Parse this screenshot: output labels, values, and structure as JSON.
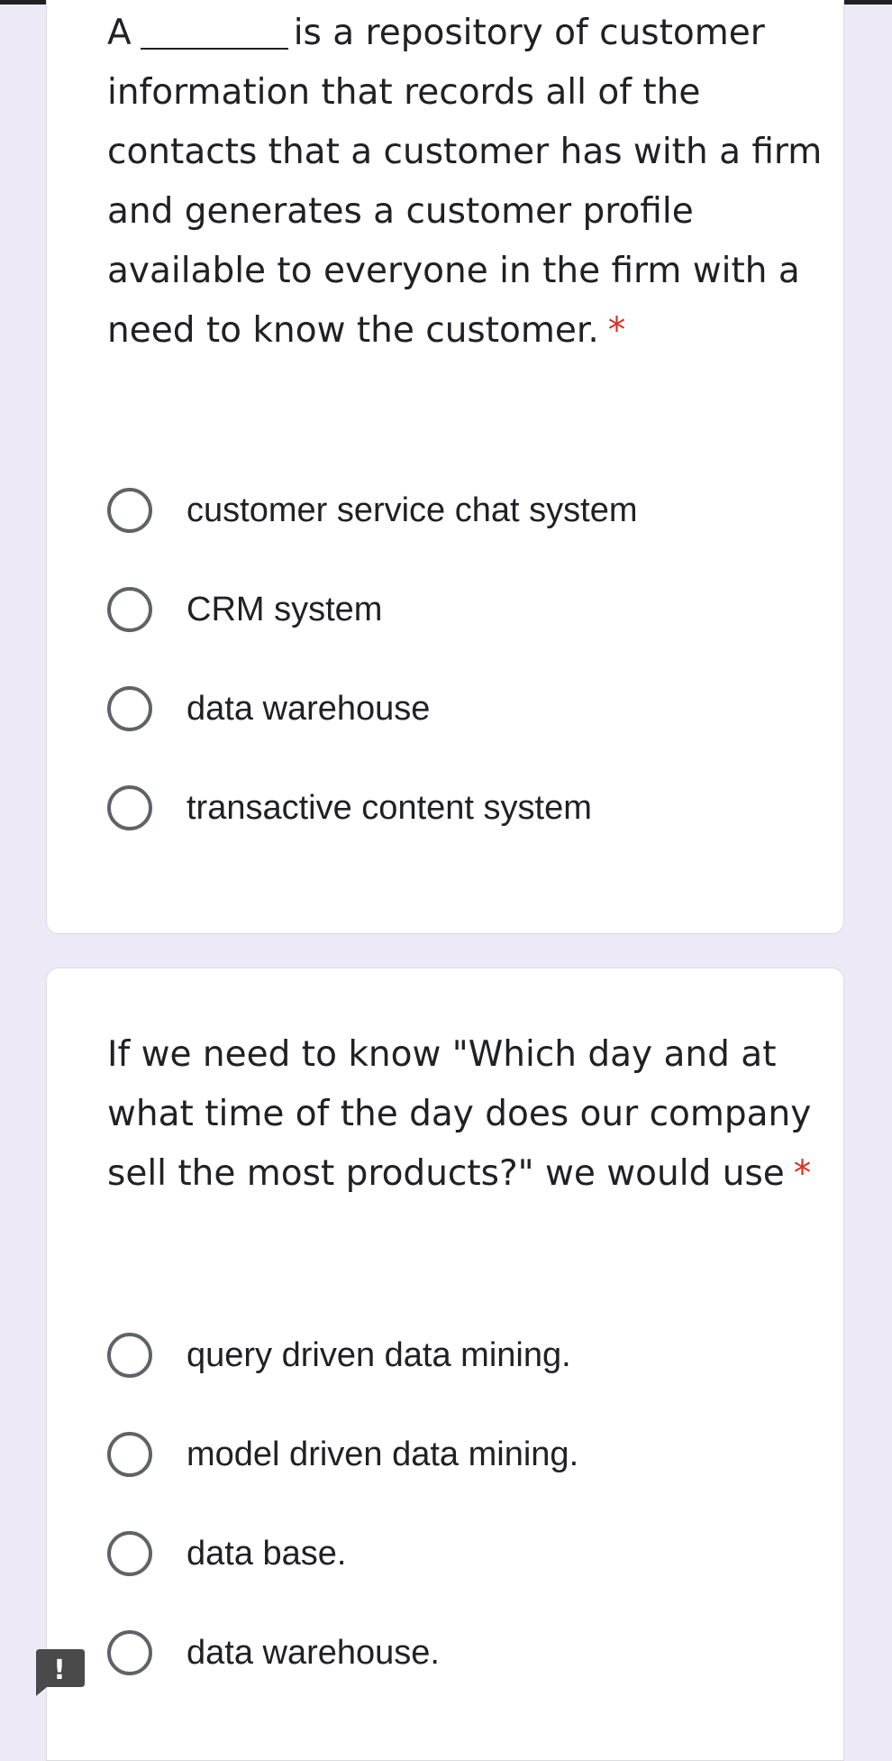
{
  "questions": [
    {
      "prefix": "A",
      "text": "is a repository of customer information that records all of the contacts that a customer has with a firm and generates a customer profile available to everyone in the firm with a need to know the customer.",
      "required_mark": "*",
      "options": [
        "customer service chat system",
        "CRM system",
        "data warehouse",
        "transactive content system"
      ]
    },
    {
      "text": "If we need to know \"Which day and at what time of the day does our company sell the most products?\" we would use",
      "required_mark": "*",
      "options": [
        "query driven data mining.",
        "model driven data mining.",
        "data base.",
        "data warehouse."
      ]
    }
  ],
  "feedback_button": {
    "icon": "exclamation-icon",
    "glyph": "!"
  },
  "colors": {
    "page_background": "#ede9f7",
    "card_background": "#ffffff",
    "required": "#d93025",
    "radio_border": "#5f6368",
    "feedback_button": "#4a4a4a"
  }
}
